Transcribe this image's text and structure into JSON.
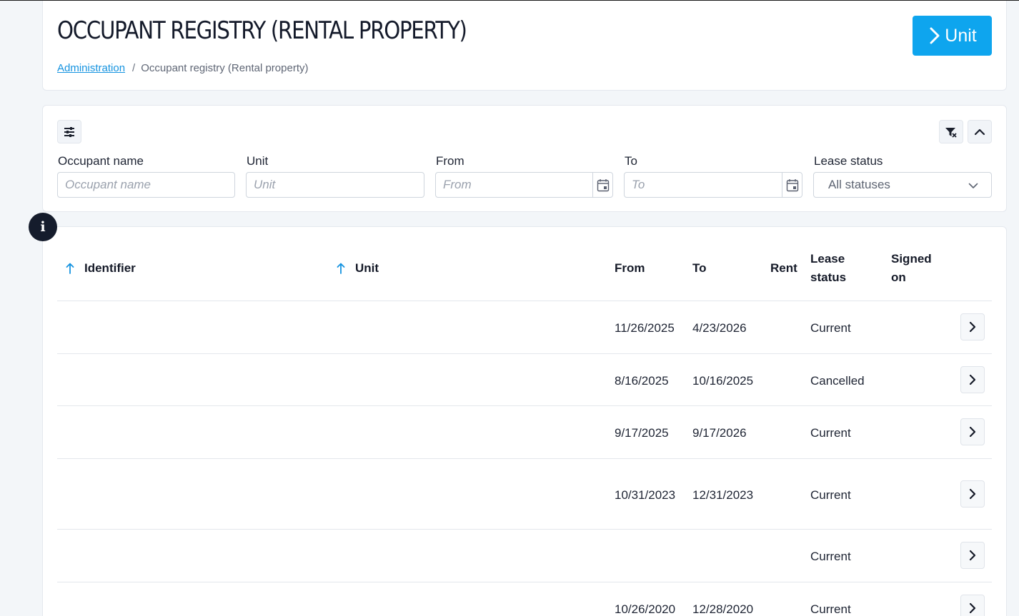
{
  "header": {
    "title": "OCCUPANT REGISTRY (RENTAL PROPERTY)",
    "breadcrumb": {
      "parent": "Administration",
      "separator": "/",
      "current": "Occupant registry (Rental property)"
    },
    "unit_button_label": "Unit"
  },
  "filters": {
    "occupant_name": {
      "label": "Occupant name",
      "placeholder": "Occupant name"
    },
    "unit": {
      "label": "Unit",
      "placeholder": "Unit"
    },
    "from": {
      "label": "From",
      "placeholder": "From"
    },
    "to": {
      "label": "To",
      "placeholder": "To"
    },
    "lease_status": {
      "label": "Lease status",
      "selected": "All statuses"
    }
  },
  "info_badge": "i",
  "table": {
    "columns": {
      "identifier": "Identifier",
      "unit": "Unit",
      "from": "From",
      "to": "To",
      "rent": "Rent",
      "lease_status_1": "Lease",
      "lease_status_2": "status",
      "signed_on_1": "Signed",
      "signed_on_2": "on"
    },
    "rows": [
      {
        "identifier": "",
        "unit": "",
        "from": "11/26/2025",
        "to": "4/23/2026",
        "rent": "",
        "status": "Current",
        "signed": ""
      },
      {
        "identifier": "",
        "unit": "",
        "from": "8/16/2025",
        "to": "10/16/2025",
        "rent": "",
        "status": "Cancelled",
        "signed": ""
      },
      {
        "identifier": "",
        "unit": "",
        "from": "9/17/2025",
        "to": "9/17/2026",
        "rent": "",
        "status": "Current",
        "signed": ""
      },
      {
        "identifier": "",
        "unit": "",
        "from": "10/31/2023",
        "to": "12/31/2023",
        "rent": "",
        "status": "Current",
        "signed": ""
      },
      {
        "identifier": "",
        "unit": "",
        "from": "",
        "to": "",
        "rent": "",
        "status": "Current",
        "signed": ""
      },
      {
        "identifier": "",
        "unit": "",
        "from": "10/26/2020",
        "to": "12/28/2020",
        "rent": "",
        "status": "Current",
        "signed": ""
      }
    ]
  },
  "colors": {
    "accent": "#0ea5ee",
    "link": "#1593e0",
    "sort_arrow": "#1593e0",
    "badge_bg": "#151c2c"
  }
}
